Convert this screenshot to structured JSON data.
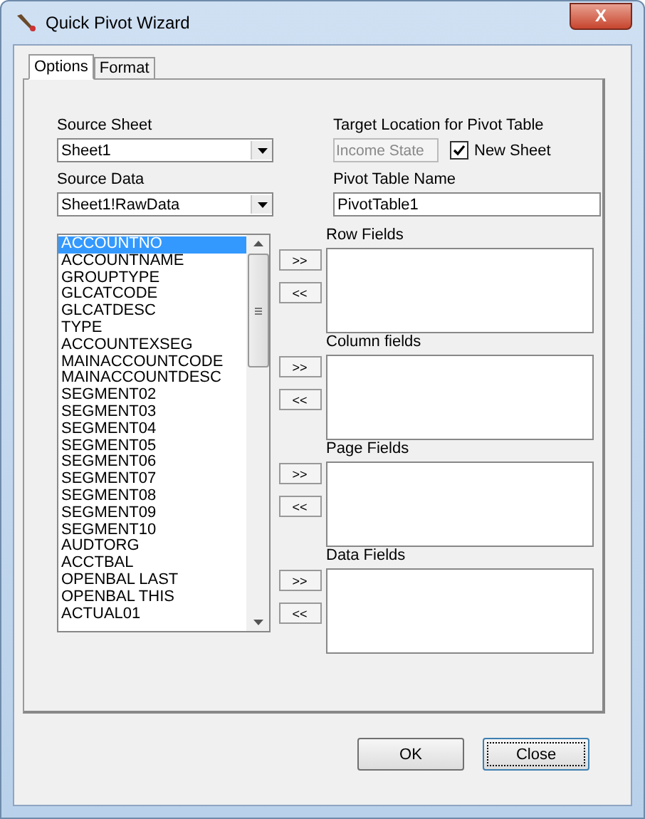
{
  "window": {
    "title": "Quick Pivot Wizard",
    "close": "X"
  },
  "tabs": [
    {
      "label": "Options",
      "selected": true
    },
    {
      "label": "Format",
      "selected": false
    }
  ],
  "source_sheet": {
    "label": "Source Sheet",
    "value": "Sheet1"
  },
  "source_data": {
    "label": "Source Data",
    "value": "Sheet1!RawData"
  },
  "fields": [
    {
      "name": "ACCOUNTNO",
      "selected": true
    },
    {
      "name": "ACCOUNTNAME",
      "selected": false
    },
    {
      "name": "GROUPTYPE",
      "selected": false
    },
    {
      "name": "GLCATCODE",
      "selected": false
    },
    {
      "name": "GLCATDESC",
      "selected": false
    },
    {
      "name": "TYPE",
      "selected": false
    },
    {
      "name": "ACCOUNTEXSEG",
      "selected": false
    },
    {
      "name": "MAINACCOUNTCODE",
      "selected": false
    },
    {
      "name": "MAINACCOUNTDESC",
      "selected": false
    },
    {
      "name": "SEGMENT02",
      "selected": false
    },
    {
      "name": "SEGMENT03",
      "selected": false
    },
    {
      "name": "SEGMENT04",
      "selected": false
    },
    {
      "name": "SEGMENT05",
      "selected": false
    },
    {
      "name": "SEGMENT06",
      "selected": false
    },
    {
      "name": "SEGMENT07",
      "selected": false
    },
    {
      "name": "SEGMENT08",
      "selected": false
    },
    {
      "name": "SEGMENT09",
      "selected": false
    },
    {
      "name": "SEGMENT10",
      "selected": false
    },
    {
      "name": "AUDTORG",
      "selected": false
    },
    {
      "name": "ACCTBAL",
      "selected": false
    },
    {
      "name": "OPENBAL LAST",
      "selected": false
    },
    {
      "name": "OPENBAL THIS",
      "selected": false
    },
    {
      "name": "ACTUAL01",
      "selected": false
    }
  ],
  "target": {
    "label": "Target Location for Pivot Table",
    "value": "Income State",
    "disabled": true
  },
  "new_sheet": {
    "label": "New Sheet",
    "checked": true
  },
  "pivot_name": {
    "label": "Pivot Table Name",
    "value": "PivotTable1"
  },
  "areas": [
    {
      "label": "Row Fields",
      "add": ">>",
      "remove": "<<"
    },
    {
      "label": "Column fields",
      "add": ">>",
      "remove": "<<"
    },
    {
      "label": "Page Fields",
      "add": ">>",
      "remove": "<<"
    },
    {
      "label": "Data Fields",
      "add": ">>",
      "remove": "<<"
    }
  ],
  "buttons": [
    {
      "label": "OK",
      "focused": false
    },
    {
      "label": "Close",
      "focused": true
    }
  ]
}
